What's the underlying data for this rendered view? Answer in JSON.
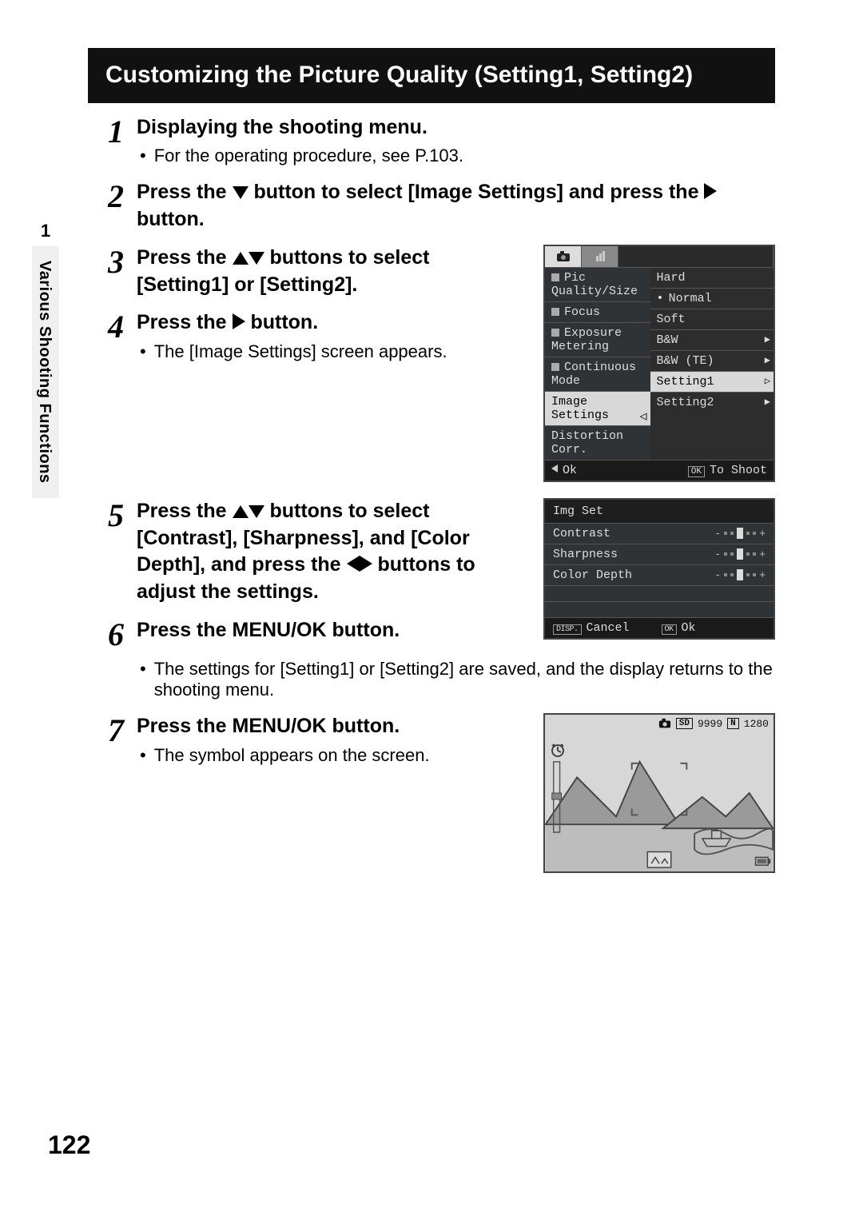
{
  "page_number": "122",
  "side_tab": {
    "number": "1",
    "label": "Various Shooting Functions"
  },
  "title": "Customizing the Picture Quality (Setting1, Setting2)",
  "steps": [
    {
      "n": "1",
      "head": "Displaying the shooting menu.",
      "sub": "For the operating procedure, see P.103."
    },
    {
      "n": "2",
      "head_a": "Press the ",
      "head_b": " button to select [Image Settings] and press the ",
      "head_c": " button."
    },
    {
      "n": "3",
      "head_a": "Press the ",
      "head_b": " buttons to select [Setting1] or [Setting2]."
    },
    {
      "n": "4",
      "head_a": "Press the ",
      "head_b": " button.",
      "sub": "The [Image Settings] screen appears."
    },
    {
      "n": "5",
      "head_a": "Press the ",
      "head_b": " buttons to select [Contrast], [Sharpness], and [Color Depth], and press the ",
      "head_c": " buttons to adjust the settings."
    },
    {
      "n": "6",
      "head": "Press the MENU/OK button.",
      "sub": "The settings for [Setting1] or [Setting2] are saved, and the display returns to the shooting menu."
    },
    {
      "n": "7",
      "head": "Press the MENU/OK button.",
      "sub": "The symbol appears on the screen."
    }
  ],
  "lcd1": {
    "left": [
      "Pic Quality/Size",
      "Focus",
      "Exposure Metering",
      "Continuous Mode",
      "Image Settings",
      "Distortion Corr."
    ],
    "right": [
      "Hard",
      "Normal",
      "Soft",
      "B&W",
      "B&W (TE)",
      "Setting1",
      "Setting2"
    ],
    "right_bullet_index": 1,
    "right_selected_index": 5,
    "left_selected_index": 4,
    "foot_left": "Ok",
    "foot_right_label": "OK",
    "foot_right": "To Shoot"
  },
  "lcd2": {
    "title": "Img Set",
    "rows": [
      "Contrast",
      "Sharpness",
      "Color Depth"
    ],
    "foot_cancel_label": "DISP.",
    "foot_cancel": "Cancel",
    "foot_ok_label": "OK",
    "foot_ok": "Ok"
  },
  "lcd3": {
    "sd_label": "SD",
    "count": "9999",
    "n_label": "N",
    "res": "1280"
  }
}
